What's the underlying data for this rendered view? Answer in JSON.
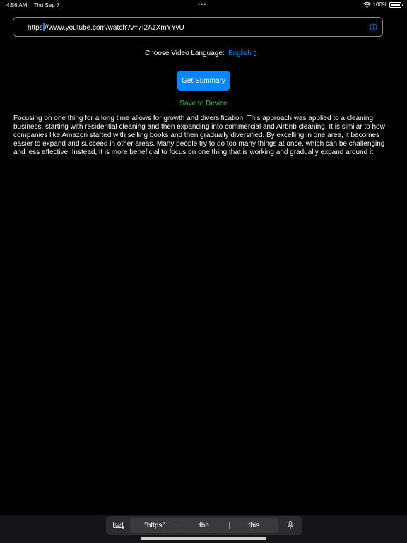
{
  "status_bar": {
    "time": "4:56 AM",
    "date": "Thu Sep 7",
    "battery_text": "100%",
    "battery_level": 1.0
  },
  "url_field": {
    "value_prefix": "https",
    "value_suffix": "//www.youtube.com/watch?v=7I2AzXmYYvU"
  },
  "language": {
    "label": "Choose Video Language:",
    "selected": "English",
    "chevron": "⌃⌄"
  },
  "actions": {
    "get_summary_label": "Get Summary",
    "save_label": "Save to Device"
  },
  "summary": {
    "text": "Focusing on one thing for a long time allows for growth and diversification. This approach was applied to a cleaning business, starting with residential cleaning and then expanding into commercial and Airbnb cleaning. It is similar to how companies like Amazon started with selling books and then gradually diversified. By excelling in one area, it becomes easier to expand and succeed in other areas. Many people try to do too many things at once, which can be challenging and less effective. Instead, it is more beneficial to focus on one thing that is working and gradually expand around it."
  },
  "keyboard_bar": {
    "suggestions": [
      "\"https\"",
      "the",
      "this"
    ]
  },
  "colors": {
    "accent": "#0a84ff",
    "save": "#30d158",
    "background": "#000000"
  },
  "icons": {
    "info": "info-circle-icon",
    "wifi": "wifi-icon",
    "battery": "battery-icon",
    "keyboard": "keyboard-icon",
    "mic": "microphone-icon"
  }
}
